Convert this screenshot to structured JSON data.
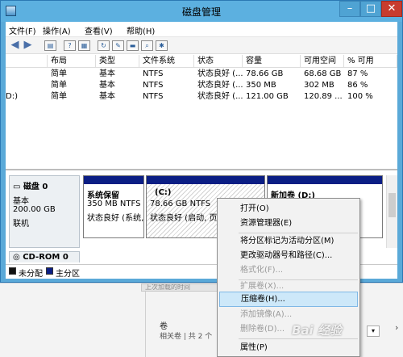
{
  "window": {
    "title": "磁盘管理"
  },
  "menubar": [
    "文件(F)",
    "操作(A)",
    "查看(V)",
    "帮助(H)"
  ],
  "toolbar": {
    "icons": [
      "back-icon",
      "forward-icon",
      "list-icon",
      "help-icon",
      "list-icon",
      "refresh-icon",
      "properties-icon",
      "folder-icon",
      "search-icon",
      "settings-icon"
    ]
  },
  "volume_list": {
    "columns": [
      "布局",
      "类型",
      "文件系统",
      "状态",
      "容量",
      "可用空间",
      "% 可用"
    ],
    "rows": [
      {
        "volume": "",
        "layout": "简单",
        "type": "基本",
        "fs": "NTFS",
        "status": "状态良好 (...",
        "capacity": "78.66 GB",
        "free": "68.68 GB",
        "pct": "87 %"
      },
      {
        "volume": "",
        "layout": "简单",
        "type": "基本",
        "fs": "NTFS",
        "status": "状态良好 (...",
        "capacity": "350 MB",
        "free": "302 MB",
        "pct": "86 %"
      },
      {
        "volume": "D:)",
        "layout": "简单",
        "type": "基本",
        "fs": "NTFS",
        "status": "状态良好 (...",
        "capacity": "121.00 GB",
        "free": "120.89 ...",
        "pct": "100 %"
      }
    ]
  },
  "disk0": {
    "name": "磁盘 0",
    "type": "基本",
    "size": "200.00 GB",
    "state": "联机",
    "partitions": [
      {
        "name": "系统保留",
        "size": "350 MB NTFS",
        "status": "状态良好 (系统,",
        "color": "#0b1e84"
      },
      {
        "name": "(C:)",
        "size": "78.66 GB NTFS",
        "status": "状态良好 (启动, 页面",
        "color": "#0b1e84"
      },
      {
        "name": "新加卷 (D:)",
        "size": "",
        "status": "",
        "color": "#0b1e84"
      }
    ]
  },
  "cdrom": {
    "name": "CD-ROM 0"
  },
  "legend": [
    {
      "label": "未分配",
      "color": "#111111"
    },
    {
      "label": "主分区",
      "color": "#0b1e84"
    }
  ],
  "context_menu": [
    {
      "label": "打开(O)",
      "disabled": false
    },
    {
      "label": "资源管理器(E)",
      "disabled": false
    },
    {
      "sep": true
    },
    {
      "label": "将分区标记为活动分区(M)",
      "disabled": false
    },
    {
      "label": "更改驱动器号和路径(C)...",
      "disabled": false
    },
    {
      "label": "格式化(F)...",
      "disabled": true
    },
    {
      "sep": true
    },
    {
      "label": "扩展卷(X)...",
      "disabled": true
    },
    {
      "label": "压缩卷(H)...",
      "disabled": false,
      "highlighted": true
    },
    {
      "label": "添加镜像(A)...",
      "disabled": true
    },
    {
      "label": "删除卷(D)...",
      "disabled": true
    },
    {
      "sep": true
    },
    {
      "label": "属性(P)",
      "disabled": false
    }
  ],
  "background_window": {
    "strip_text": "上次加载的时间",
    "volume_heading": "卷",
    "related": "相关卷 | 共 2 个"
  },
  "watermark": "Bai 经验"
}
